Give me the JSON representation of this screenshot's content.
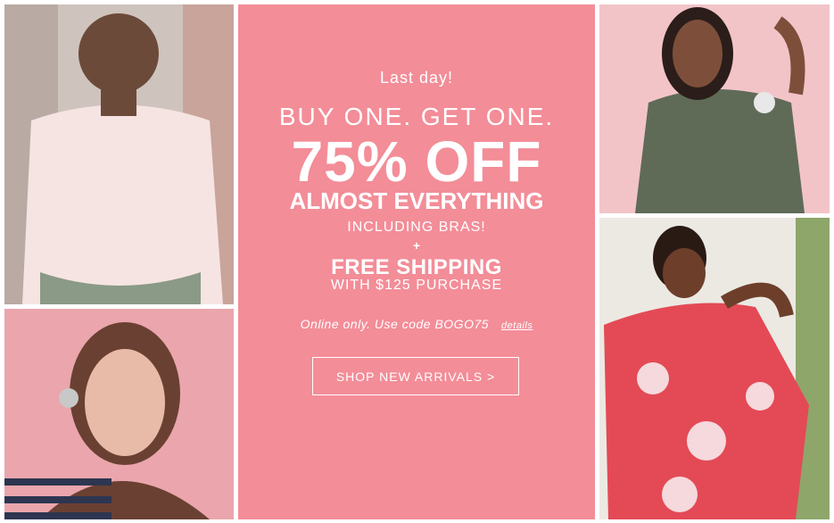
{
  "promo": {
    "eyebrow": "Last day!",
    "headline": "BUY ONE. GET ONE.",
    "discount": "75% OFF",
    "scope": "ALMOST EVERYTHING",
    "includes": "INCLUDING BRAS!",
    "plus": "+",
    "shipping": "FREE SHIPPING",
    "shipping_condition": "WITH $125 PURCHASE",
    "code_note": "Online only. Use code BOGO75",
    "details_label": "details",
    "cta_label": "SHOP NEW ARRIVALS >"
  },
  "colors": {
    "panel_bg": "#f38d98",
    "text": "#ffffff"
  }
}
